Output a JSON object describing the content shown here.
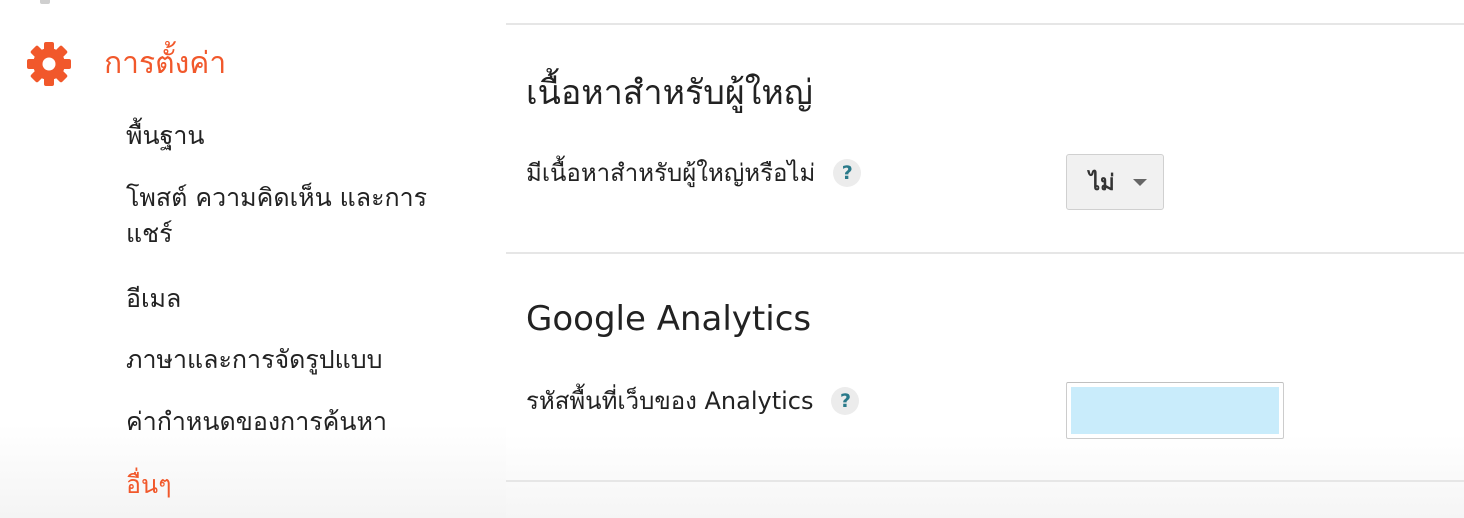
{
  "sidebar": {
    "settings_label": "การตั้งค่า",
    "settings_icon": "gear-icon",
    "accent_color": "#f1582b",
    "items": [
      {
        "label": "พื้นฐาน",
        "active": false
      },
      {
        "label": "โพสต์ ความคิดเห็น และการแชร์",
        "active": false
      },
      {
        "label": "อีเมล",
        "active": false
      },
      {
        "label": "ภาษาและการจัดรูปแบบ",
        "active": false
      },
      {
        "label": "ค่ากำหนดของการค้นหา",
        "active": false
      },
      {
        "label": "อื่นๆ",
        "active": true
      }
    ]
  },
  "main": {
    "adult_section": {
      "title": "เนื้อหาสำหรับผู้ใหญ่",
      "field_label": "มีเนื้อหาสำหรับผู้ใหญ่หรือไม่",
      "help_label": "?",
      "select_value": "ไม่"
    },
    "analytics_section": {
      "title": "Google Analytics",
      "field_label": "รหัสพื้นที่เว็บของ Analytics",
      "help_label": "?",
      "input_value": ""
    }
  }
}
